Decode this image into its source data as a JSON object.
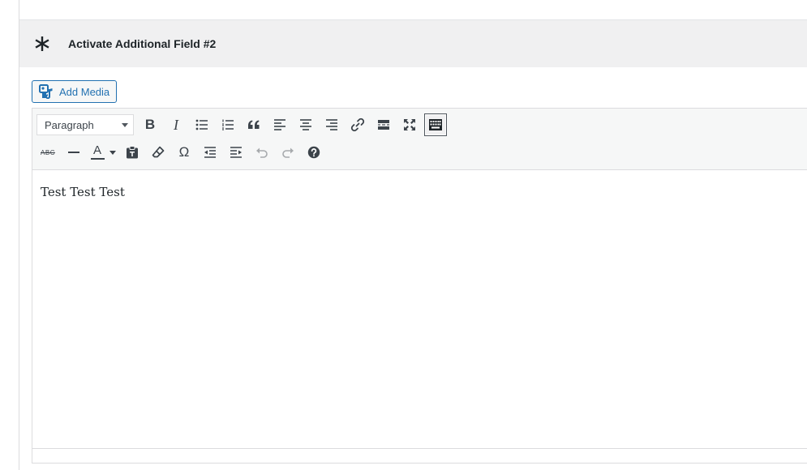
{
  "section": {
    "title": "Activate Additional Field #2"
  },
  "media": {
    "add_media_label": "Add Media"
  },
  "toolbar": {
    "format_select_value": "Paragraph",
    "text_color_glyph": "A",
    "special_char_glyph": "Ω",
    "strike_glyph": "ABC",
    "bold_glyph": "B",
    "italic_glyph": "I",
    "quote_glyph": "“"
  },
  "editor": {
    "content": "Test Test Test"
  },
  "colors": {
    "accent": "#2271b1",
    "header_bg": "#f0f0f1",
    "icon": "#3c434a",
    "icon_disabled": "#a7aaad"
  }
}
